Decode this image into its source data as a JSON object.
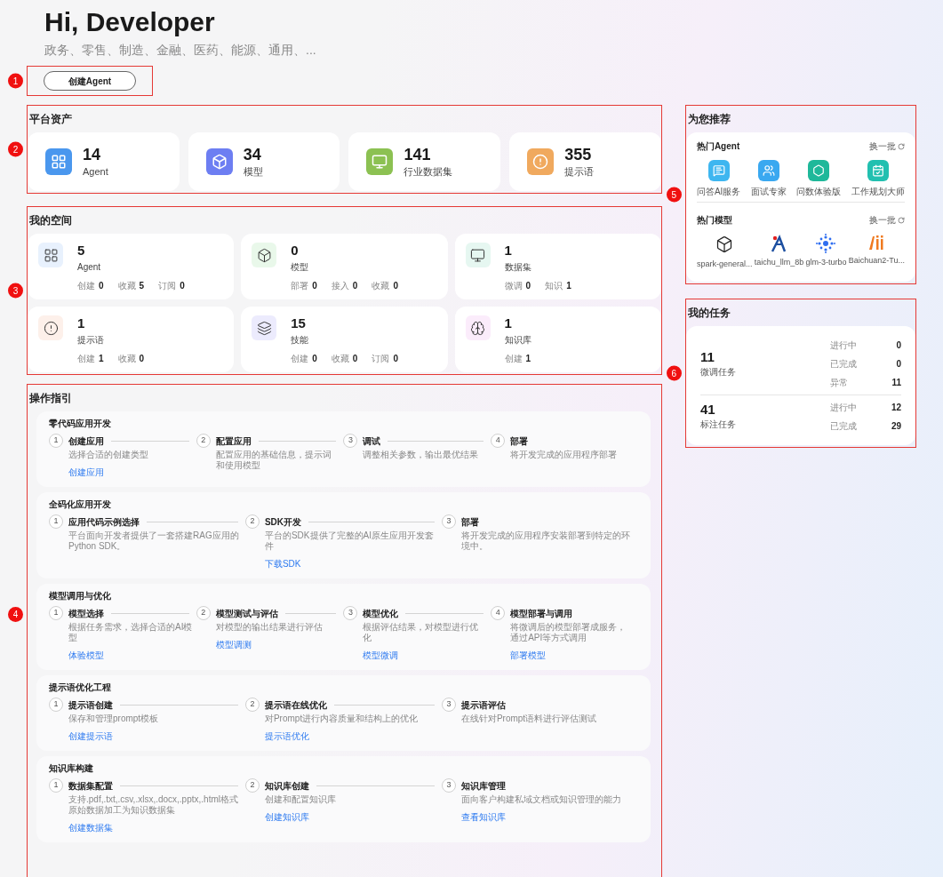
{
  "hero": {
    "title": "Hi, Developer",
    "subtitle": "政务、零售、制造、金融、医药、能源、通用、...",
    "button": {
      "label": "创建Agent",
      "callout": "1"
    }
  },
  "platform_assets": {
    "title": "平台资产",
    "callout": "2",
    "cards": [
      {
        "kind": "agent",
        "value": "14",
        "label": "Agent"
      },
      {
        "kind": "model",
        "value": "34",
        "label": "模型"
      },
      {
        "kind": "dataset",
        "value": "141",
        "label": "行业数据集"
      },
      {
        "kind": "prompt",
        "value": "355",
        "label": "提示语"
      }
    ]
  },
  "my_space": {
    "title": "我的空间",
    "callout": "3",
    "cards": [
      {
        "kind": "agent",
        "value": "5",
        "label": "Agent",
        "stats": [
          {
            "label": "创建",
            "value": "0"
          },
          {
            "label": "收藏",
            "value": "5"
          },
          {
            "label": "订阅",
            "value": "0"
          }
        ]
      },
      {
        "kind": "model",
        "value": "0",
        "label": "模型",
        "stats": [
          {
            "label": "部署",
            "value": "0"
          },
          {
            "label": "接入",
            "value": "0"
          },
          {
            "label": "收藏",
            "value": "0"
          }
        ]
      },
      {
        "kind": "dataset",
        "value": "1",
        "label": "数据集",
        "stats": [
          {
            "label": "微调",
            "value": "0"
          },
          {
            "label": "知识",
            "value": "1"
          }
        ]
      },
      {
        "kind": "prompt",
        "value": "1",
        "label": "提示语",
        "stats": [
          {
            "label": "创建",
            "value": "1"
          },
          {
            "label": "收藏",
            "value": "0"
          }
        ]
      },
      {
        "kind": "skill",
        "value": "15",
        "label": "技能",
        "stats": [
          {
            "label": "创建",
            "value": "0"
          },
          {
            "label": "收藏",
            "value": "0"
          },
          {
            "label": "订阅",
            "value": "0"
          }
        ]
      },
      {
        "kind": "knowledge",
        "value": "1",
        "label": "知识库",
        "stats": [
          {
            "label": "创建",
            "value": "1"
          }
        ]
      }
    ]
  },
  "guide": {
    "title": "操作指引",
    "callout": "4",
    "sections": [
      {
        "title": "零代码应用开发",
        "steps": [
          {
            "number": "1",
            "title": "创建应用",
            "desc": "选择合适的创建类型",
            "link": "创建应用"
          },
          {
            "number": "2",
            "title": "配置应用",
            "desc": "配置应用的基础信息，提示词和使用模型"
          },
          {
            "number": "3",
            "title": "调试",
            "desc": "调整相关参数，输出最优结果"
          },
          {
            "number": "4",
            "title": "部署",
            "desc": "将开发完成的应用程序部署"
          }
        ]
      },
      {
        "title": "全码化应用开发",
        "steps": [
          {
            "number": "1",
            "title": "应用代码示例选择",
            "desc": "平台面向开发者提供了一套搭建RAG应用的Python SDK。"
          },
          {
            "number": "2",
            "title": "SDK开发",
            "desc": "平台的SDK提供了完整的AI原生应用开发套件",
            "link": "下载SDK"
          },
          {
            "number": "3",
            "title": "部署",
            "desc": "将开发完成的应用程序安装部署到特定的环境中。"
          }
        ]
      },
      {
        "title": "模型调用与优化",
        "steps": [
          {
            "number": "1",
            "title": "模型选择",
            "desc": "根据任务需求，选择合适的AI模型",
            "link": "体验模型"
          },
          {
            "number": "2",
            "title": "模型测试与评估",
            "desc": "对模型的输出结果进行评估",
            "link": "模型调测"
          },
          {
            "number": "3",
            "title": "模型优化",
            "desc": "根据评估结果，对模型进行优化",
            "link": "模型微调"
          },
          {
            "number": "4",
            "title": "模型部署与调用",
            "desc": "将微调后的模型部署成服务，通过API等方式调用",
            "link": "部署模型"
          }
        ]
      },
      {
        "title": "提示语优化工程",
        "steps": [
          {
            "number": "1",
            "title": "提示语创建",
            "desc": "保存和管理prompt模板",
            "link": "创建提示语"
          },
          {
            "number": "2",
            "title": "提示语在线优化",
            "desc": "对Prompt进行内容质量和结构上的优化",
            "link": "提示语优化"
          },
          {
            "number": "3",
            "title": "提示语评估",
            "desc": "在线针对Prompt语料进行评估测试"
          }
        ]
      },
      {
        "title": "知识库构建",
        "steps": [
          {
            "number": "1",
            "title": "数据集配置",
            "desc": "支持.pdf,.txt,.csv,.xlsx,.docx,.pptx,.html格式原始数据加工为知识数据集",
            "link": "创建数据集"
          },
          {
            "number": "2",
            "title": "知识库创建",
            "desc": "创建和配置知识库",
            "link": "创建知识库"
          },
          {
            "number": "3",
            "title": "知识库管理",
            "desc": "面向客户构建私域文档或知识管理的能力",
            "link": "查看知识库"
          }
        ]
      }
    ]
  },
  "recommend": {
    "title": "为您推荐",
    "callout": "5",
    "groups": [
      {
        "title": "热门Agent",
        "refresh": "换一批",
        "items": [
          {
            "kind": "chat",
            "label": "问答AI服务"
          },
          {
            "kind": "people",
            "label": "面试专家"
          },
          {
            "kind": "hexagon",
            "label": "问数体验版"
          },
          {
            "kind": "calendar",
            "label": "工作规划大师"
          }
        ]
      },
      {
        "title": "热门模型",
        "refresh": "换一批",
        "items": [
          {
            "kind": "cube",
            "label": "spark-general..."
          },
          {
            "kind": "figure",
            "label": "taichu_llm_8b"
          },
          {
            "kind": "dots",
            "label": "glm-3-turbo"
          },
          {
            "kind": "bars",
            "label": "Baichuan2-Tu..."
          }
        ]
      }
    ]
  },
  "tasks": {
    "title": "我的任务",
    "callout": "6",
    "groups": [
      {
        "value": "11",
        "label": "微调任务",
        "stats": [
          {
            "label": "进行中",
            "value": "0"
          },
          {
            "label": "已完成",
            "value": "0"
          },
          {
            "label": "异常",
            "value": "11"
          }
        ]
      },
      {
        "value": "41",
        "label": "标注任务",
        "stats": [
          {
            "label": "进行中",
            "value": "12"
          },
          {
            "label": "已完成",
            "value": "29"
          }
        ]
      }
    ]
  }
}
